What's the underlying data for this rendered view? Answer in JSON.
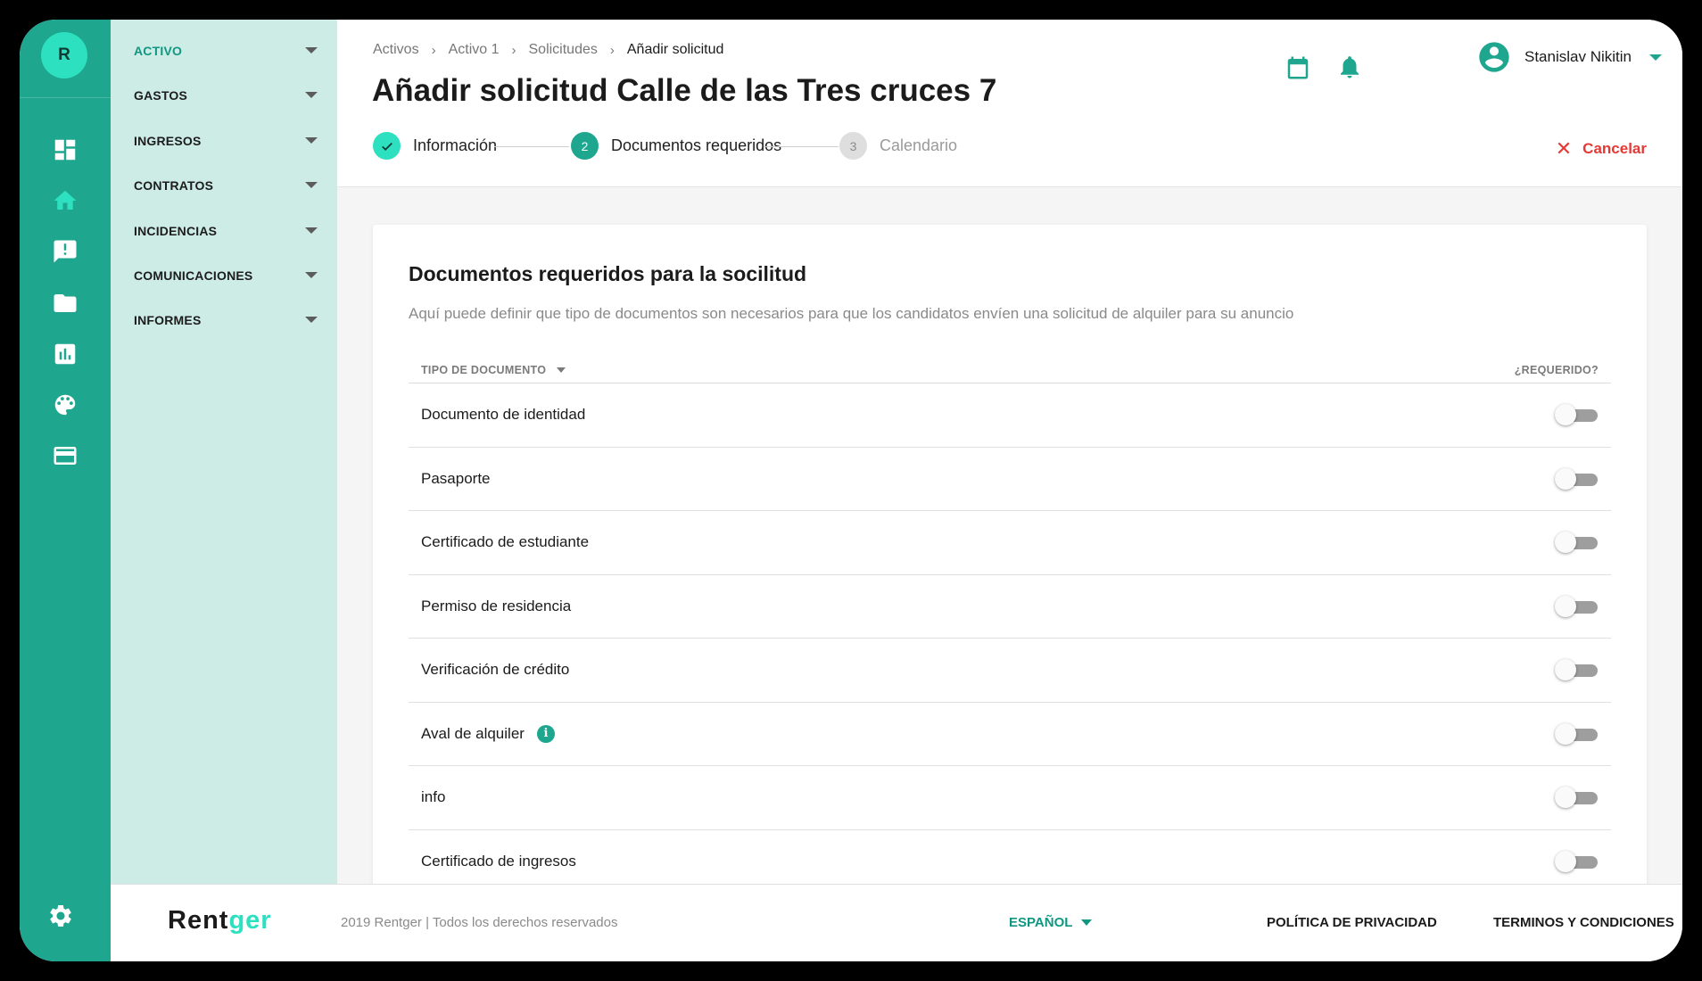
{
  "brand": {
    "avatar_letter": "R",
    "logo_main": "Rent",
    "logo_accent": "ger",
    "accent_color": "#1fa68f",
    "highlight_color": "#2ce0c0"
  },
  "rail": {
    "icons": [
      "dashboard-icon",
      "home-icon",
      "alert-icon",
      "folder-icon",
      "chart-icon",
      "palette-icon",
      "credit-card-icon",
      "settings-icon"
    ]
  },
  "sidebar": {
    "items": [
      {
        "label": "ACTIVO",
        "active": true
      },
      {
        "label": "GASTOS"
      },
      {
        "label": "INGRESOS"
      },
      {
        "label": "CONTRATOS"
      },
      {
        "label": "INCIDENCIAS"
      },
      {
        "label": "COMUNICACIONES"
      },
      {
        "label": "INFORMES"
      }
    ]
  },
  "breadcrumb": [
    "Activos",
    "Activo 1",
    "Solicitudes",
    "Añadir solicitud"
  ],
  "page_title": "Añadir solicitud Calle de las Tres cruces 7",
  "stepper": {
    "steps": [
      {
        "label": "Información",
        "state": "done"
      },
      {
        "number": "2",
        "label": "Documentos requeridos",
        "state": "active"
      },
      {
        "number": "3",
        "label": "Calendario",
        "state": "pending"
      }
    ]
  },
  "header": {
    "user_name": "Stanislav Nikitin",
    "cancel_label": "Cancelar"
  },
  "card": {
    "title": "Documentos requeridos para la socilitud",
    "subtitle": "Aquí puede definir que tipo de documentos son necesarios para que los candidatos envíen una solicitud de alquiler para su anuncio",
    "col_type": "TIPO DE DOCUMENTO",
    "col_required": "¿REQUERIDO?",
    "rows": [
      {
        "label": "Documento de identidad",
        "required": false
      },
      {
        "label": "Pasaporte",
        "required": false
      },
      {
        "label": "Certificado de estudiante",
        "required": false
      },
      {
        "label": "Permiso de residencia",
        "required": false
      },
      {
        "label": "Verificación de crédito",
        "required": false
      },
      {
        "label": "Aval de alquiler",
        "required": false,
        "info_icon": "i"
      },
      {
        "label": "info",
        "required": false
      },
      {
        "label": "Certificado de ingresos",
        "required": false
      }
    ]
  },
  "footer": {
    "copyright": "2019 Rentger | Todos los derechos reservados",
    "language": "ESPAÑOL",
    "privacy": "POLÍTICA DE PRIVACIDAD",
    "terms": "TERMINOS Y CONDICIONES"
  }
}
